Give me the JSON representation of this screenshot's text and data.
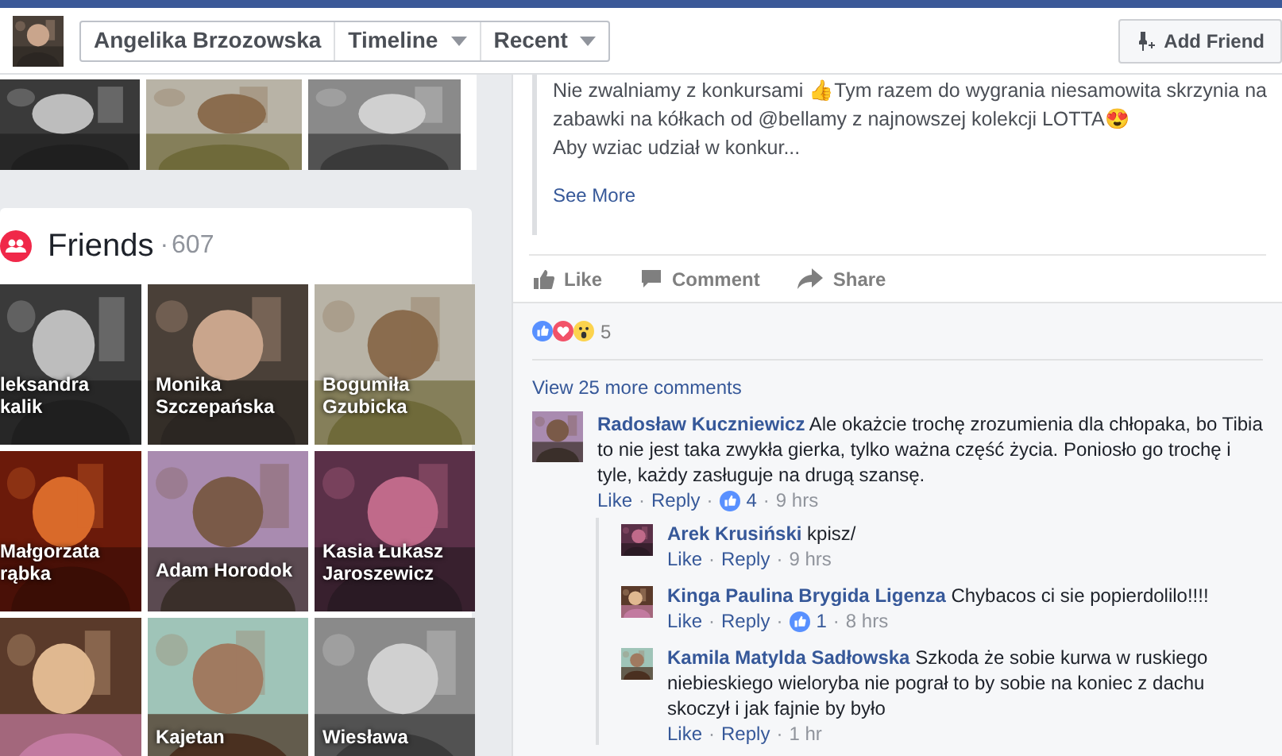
{
  "header": {
    "profile_name": "Angelika Brzozowska",
    "menus": [
      {
        "label": "Timeline"
      },
      {
        "label": "Recent"
      }
    ],
    "add_friend": "Add Friend"
  },
  "post": {
    "lines": [
      "Nie zwalniamy z konkursami 👍Tym razem do wygrania niesamowita skrzynia na",
      "zabawki na kółkach od @bellamy z najnowszej kolekcji LOTTA😍",
      "Aby wziac udział w konkur..."
    ],
    "see_more": "See More",
    "actions": [
      {
        "kind": "like",
        "label": "Like"
      },
      {
        "kind": "comment",
        "label": "Comment"
      },
      {
        "kind": "share",
        "label": "Share"
      }
    ]
  },
  "reactions": {
    "count": "5"
  },
  "view_more": "View 25 more comments",
  "separator": "·",
  "comments": [
    {
      "author": "Radosław Kuczniewicz",
      "text": "Ale okażcie trochę zrozumienia dla chłopaka, bo Tibia to nie jest taka zwykła gierka, tylko ważna część życia. Poniosło go trochę i tyle, każdy zasługuje na drugą szansę.",
      "like": "Like",
      "reply": "Reply",
      "likes": "4",
      "time": "9 hrs",
      "replies": [
        {
          "author": "Arek Krusiński",
          "text": "kpisz/",
          "like": "Like",
          "reply": "Reply",
          "time": "9 hrs"
        },
        {
          "author": "Kinga Paulina Brygida Ligenza",
          "text": "Chybacos ci sie popierdolilo!!!!",
          "like": "Like",
          "reply": "Reply",
          "likes": "1",
          "time": "8 hrs"
        },
        {
          "author": "Kamila Matylda Sadłowska",
          "text": "Szkoda że sobie kurwa w ruskiego niebieskiego wieloryba nie pograł to by sobie na koniec z dachu skoczył i jak fajnie by było",
          "like": "Like",
          "reply": "Reply",
          "time": "1 hr"
        }
      ]
    }
  ],
  "friends": {
    "title": "Friends",
    "count": "607",
    "items": [
      {
        "kind": "picture",
        "lines": [
          "leksandra",
          "kalik"
        ]
      },
      {
        "kind": "picture",
        "lines": [
          "Monika",
          "Szczepańska"
        ]
      },
      {
        "kind": "picture",
        "lines": [
          "Bogumiła",
          "Gzubicka"
        ]
      },
      {
        "kind": "picture",
        "lines": [
          "Małgorzata",
          "rąbka"
        ]
      },
      {
        "kind": "picture",
        "lines": [
          "Adam Horodok"
        ]
      },
      {
        "kind": "picture",
        "lines": [
          "Kasia Łukasz",
          "Jaroszewicz"
        ]
      },
      {
        "kind": "picture"
      },
      {
        "kind": "picture",
        "lines": [
          "Kajetan"
        ]
      },
      {
        "kind": "picture",
        "lines": [
          "Wiesława"
        ]
      }
    ]
  }
}
